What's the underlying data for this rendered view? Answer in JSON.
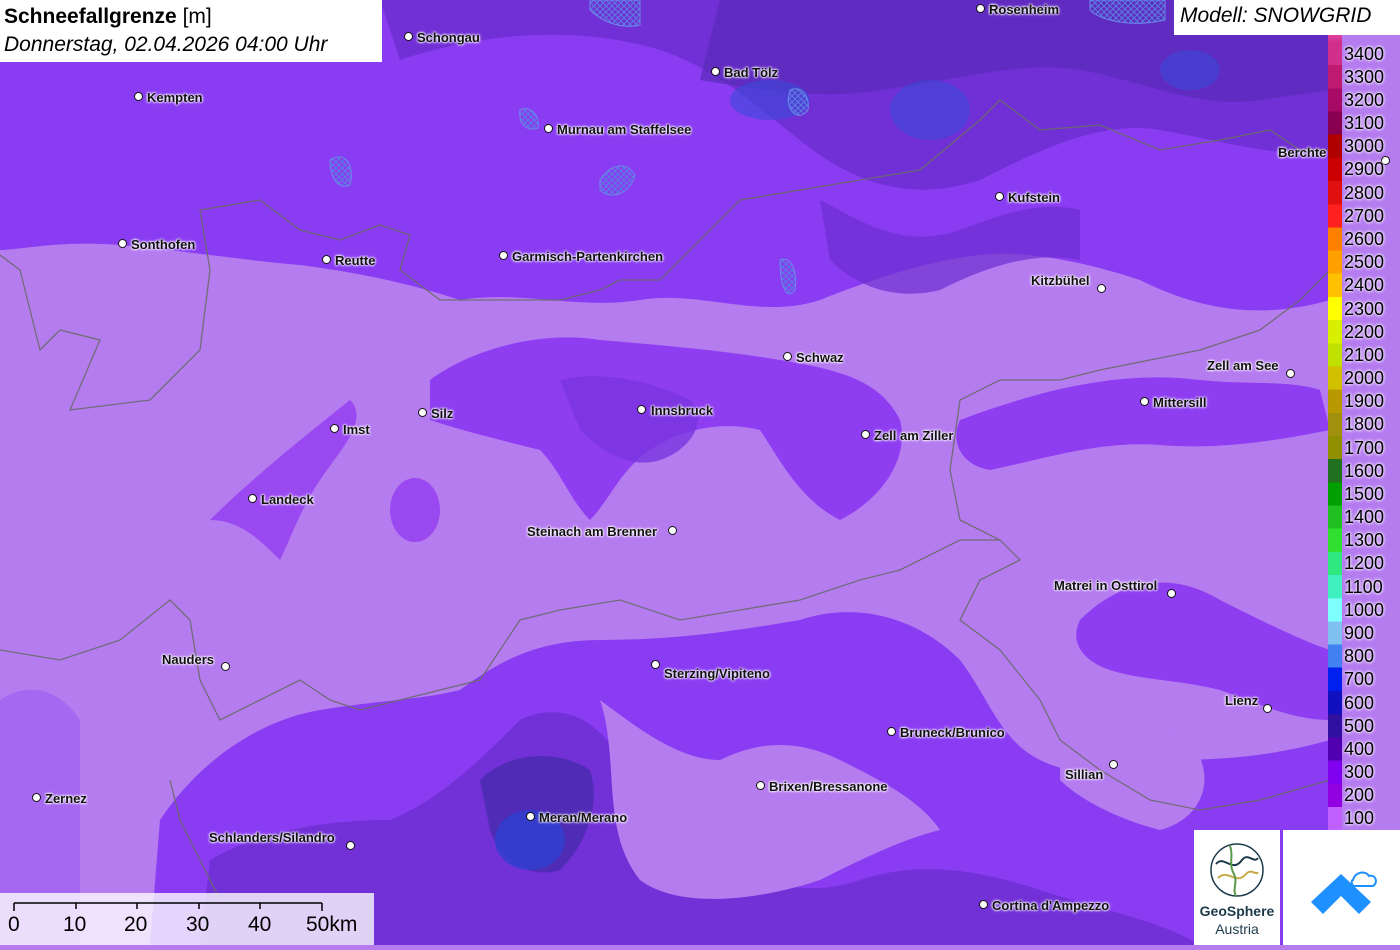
{
  "title": {
    "bold": "Schneefallgrenze",
    "unit": "[m]",
    "datetime": "Donnerstag, 02.04.2026 04:00 Uhr"
  },
  "model": "Modell: SNOWGRID",
  "cities": [
    {
      "name": "Schongau",
      "label": "Schongau",
      "side": "r"
    },
    {
      "name": "Rosenheim",
      "label": "Rosenheim",
      "side": "r"
    },
    {
      "name": "Kempten",
      "label": "Kempten",
      "side": "r"
    },
    {
      "name": "Bad Tölz",
      "label": "Bad Tölz",
      "side": "r"
    },
    {
      "name": "Murnau",
      "label": "Murnau am Staffelsee",
      "side": "r"
    },
    {
      "name": "Berchtesgaden",
      "label": "Berchte",
      "side": "l"
    },
    {
      "name": "Kufstein",
      "label": "Kufstein",
      "side": "r"
    },
    {
      "name": "Sonthofen",
      "label": "Sonthofen",
      "side": "r"
    },
    {
      "name": "Reutte",
      "label": "Reutte",
      "side": "r"
    },
    {
      "name": "Garmisch",
      "label": "Garmisch-Partenkirchen",
      "side": "r"
    },
    {
      "name": "Kitzbühel",
      "label": "Kitzbühel",
      "side": "l"
    },
    {
      "name": "Schwaz",
      "label": "Schwaz",
      "side": "r"
    },
    {
      "name": "Zell am See",
      "label": "Zell am See",
      "side": "l"
    },
    {
      "name": "Mittersill",
      "label": "Mittersill",
      "side": "r"
    },
    {
      "name": "Innsbruck",
      "label": "Innsbruck",
      "side": "r"
    },
    {
      "name": "Silz",
      "label": "Silz",
      "side": "r"
    },
    {
      "name": "Imst",
      "label": "Imst",
      "side": "r"
    },
    {
      "name": "Zell am Ziller",
      "label": "Zell am Ziller",
      "side": "r"
    },
    {
      "name": "Landeck",
      "label": "Landeck",
      "side": "r"
    },
    {
      "name": "Steinach",
      "label": "Steinach am Brenner",
      "side": "l"
    },
    {
      "name": "Matrei",
      "label": "Matrei in Osttirol",
      "side": "l"
    },
    {
      "name": "Nauders",
      "label": "Nauders",
      "side": "l"
    },
    {
      "name": "Sterzing",
      "label": "Sterzing/Vipiteno",
      "side": "r"
    },
    {
      "name": "Lienz",
      "label": "Lienz",
      "side": "l"
    },
    {
      "name": "Bruneck",
      "label": "Bruneck/Brunico",
      "side": "r"
    },
    {
      "name": "Sillian",
      "label": "Sillian",
      "side": "l"
    },
    {
      "name": "Brixen",
      "label": "Brixen/Bressanone",
      "side": "r"
    },
    {
      "name": "Zernez",
      "label": "Zernez",
      "side": "r"
    },
    {
      "name": "Meran",
      "label": "Meran/Merano",
      "side": "r"
    },
    {
      "name": "Schlanders",
      "label": "Schlanders/Silandro",
      "side": "l"
    },
    {
      "name": "Cortina",
      "label": "Cortina d'Ampezzo",
      "side": "r"
    }
  ],
  "legend": {
    "labels": [
      "3400",
      "3300",
      "3200",
      "3100",
      "3000",
      "2900",
      "2800",
      "2700",
      "2600",
      "2500",
      "2400",
      "2300",
      "2200",
      "2100",
      "2000",
      "1900",
      "1800",
      "1700",
      "1600",
      "1500",
      "1400",
      "1300",
      "1200",
      "1100",
      "1000",
      "900",
      "800",
      "700",
      "600",
      "500",
      "400",
      "300",
      "200",
      "100"
    ],
    "colors": [
      "#d0308c",
      "#c01a70",
      "#a80a68",
      "#8a0050",
      "#b00000",
      "#cc0000",
      "#e01010",
      "#ff2020",
      "#ff8000",
      "#ffa000",
      "#ffc000",
      "#ffff00",
      "#d8f000",
      "#c0e000",
      "#d0c000",
      "#b89a00",
      "#a0900c",
      "#909000",
      "#207020",
      "#00a000",
      "#20c020",
      "#30e030",
      "#30e880",
      "#40f0c0",
      "#80ffff",
      "#80c0f0",
      "#4080f0",
      "#0020f0",
      "#1010c0",
      "#3010a0",
      "#5000b0",
      "#8000f0",
      "#9000e0",
      "#c060ff"
    ]
  },
  "scale": {
    "labels": [
      "0",
      "10",
      "20",
      "30",
      "40",
      "50km"
    ]
  },
  "logos": {
    "geosphere_name": "GeoSphere",
    "geosphere_country": "Austria"
  }
}
